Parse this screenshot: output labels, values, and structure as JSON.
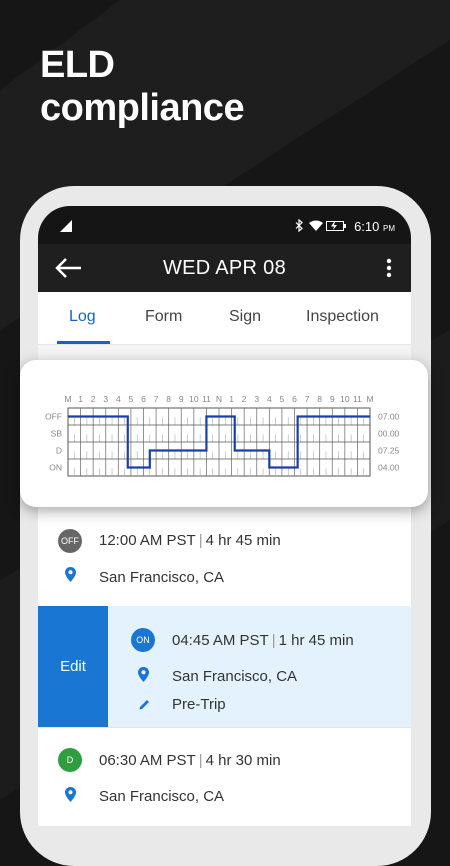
{
  "headline": {
    "line1": "ELD",
    "line2": "compliance"
  },
  "status_bar": {
    "time": "6:10",
    "ampm": "PM"
  },
  "app_bar": {
    "title": "WED APR 08"
  },
  "tabs": [
    {
      "label": "Log",
      "active": true
    },
    {
      "label": "Form",
      "active": false
    },
    {
      "label": "Sign",
      "active": false
    },
    {
      "label": "Inspection",
      "active": false
    }
  ],
  "chart_data": {
    "type": "line",
    "x_ticks": [
      "M",
      "1",
      "2",
      "3",
      "4",
      "5",
      "6",
      "7",
      "8",
      "9",
      "10",
      "11",
      "N",
      "1",
      "2",
      "3",
      "4",
      "5",
      "6",
      "7",
      "8",
      "9",
      "10",
      "11",
      "M"
    ],
    "y_categories": [
      "OFF",
      "SB",
      "D",
      "ON"
    ],
    "right_totals": [
      "07.00",
      "00.00",
      "07.25",
      "04.00"
    ],
    "segments": [
      {
        "status": "OFF",
        "start": 0,
        "end": 4.75
      },
      {
        "status": "ON",
        "start": 4.75,
        "end": 6.5
      },
      {
        "status": "D",
        "start": 6.5,
        "end": 11
      },
      {
        "status": "OFF",
        "start": 11,
        "end": 13.25
      },
      {
        "status": "D",
        "start": 13.25,
        "end": 16
      },
      {
        "status": "ON",
        "start": 16,
        "end": 18.25
      },
      {
        "status": "OFF",
        "start": 18.25,
        "end": 24
      }
    ],
    "line_color": "#1a3fa8"
  },
  "log_entries": [
    {
      "badge": "OFF",
      "badge_color": "#666666",
      "time": "12:00 AM PST",
      "duration": "4 hr 45 min",
      "location": "San Francisco, CA"
    },
    {
      "badge": "ON",
      "badge_color": "#1976d2",
      "time": "04:45 AM PST",
      "duration": "1 hr 45 min",
      "location": "San Francisco, CA",
      "note": "Pre-Trip",
      "action": "Edit"
    },
    {
      "badge": "D",
      "badge_color": "#2e9e3e",
      "time": "06:30 AM PST",
      "duration": "4 hr 30 min",
      "location": "San Francisco, CA"
    }
  ]
}
